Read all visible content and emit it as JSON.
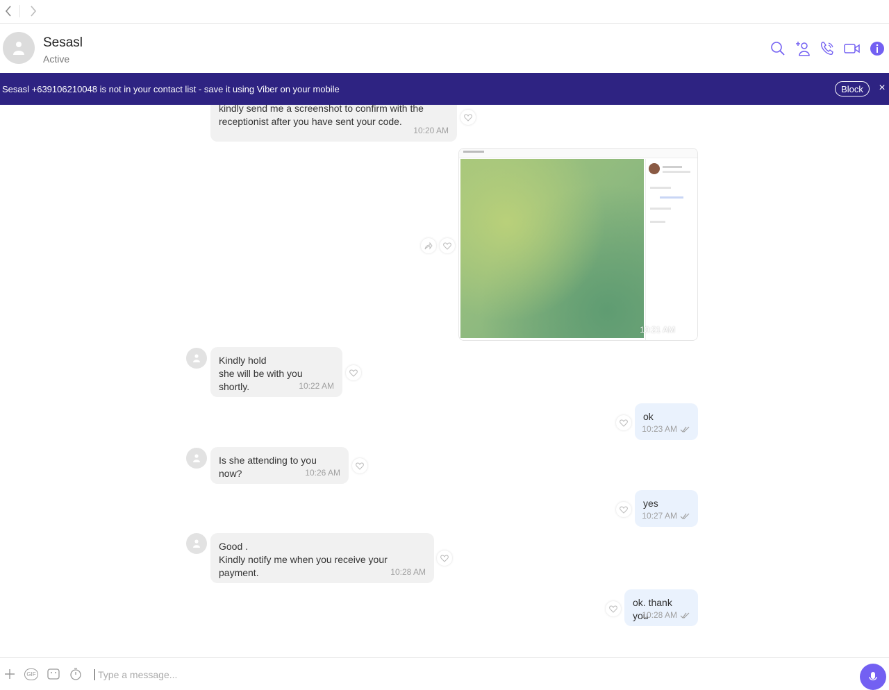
{
  "header": {
    "contact_name": "Sesasl",
    "contact_status": "Active"
  },
  "banner": {
    "text": "Sesasl +639106210048 is not in your contact list - save it using Viber on your mobile",
    "block_label": "Block",
    "close_label": "×"
  },
  "messages": [
    {
      "direction": "in",
      "text": "kindly send me a screenshot to confirm with the\nreceptionist after you have sent your code.",
      "time": "10:20 AM"
    },
    {
      "direction": "out",
      "type": "image",
      "time": "10:21 AM"
    },
    {
      "direction": "in",
      "text": "Kindly hold\nshe will be with you shortly.",
      "time": "10:22 AM"
    },
    {
      "direction": "out",
      "text": "ok",
      "time": "10:23 AM"
    },
    {
      "direction": "in",
      "text": "Is she attending to you now?",
      "time": "10:26 AM"
    },
    {
      "direction": "out",
      "text": "yes",
      "time": "10:27 AM"
    },
    {
      "direction": "in",
      "text": "Good .\nKindly notify me when you receive your payment.",
      "time": "10:28 AM"
    },
    {
      "direction": "out",
      "text": "ok. thank you",
      "time": "10:28 AM"
    }
  ],
  "composer": {
    "placeholder": "Type a message...",
    "gif_label": "GIF"
  },
  "colors": {
    "banner_bg": "#2e2382",
    "accent": "#7360f2",
    "incoming_bubble": "#f1f1f1",
    "outgoing_bubble": "#eaf2fd"
  },
  "icons": [
    "back-icon",
    "forward-icon",
    "search-icon",
    "add-participant-icon",
    "call-icon",
    "video-icon",
    "info-icon",
    "heart-icon",
    "share-icon",
    "plus-icon",
    "gif-icon",
    "sticker-icon",
    "timer-icon",
    "mic-icon",
    "double-check-icon"
  ]
}
